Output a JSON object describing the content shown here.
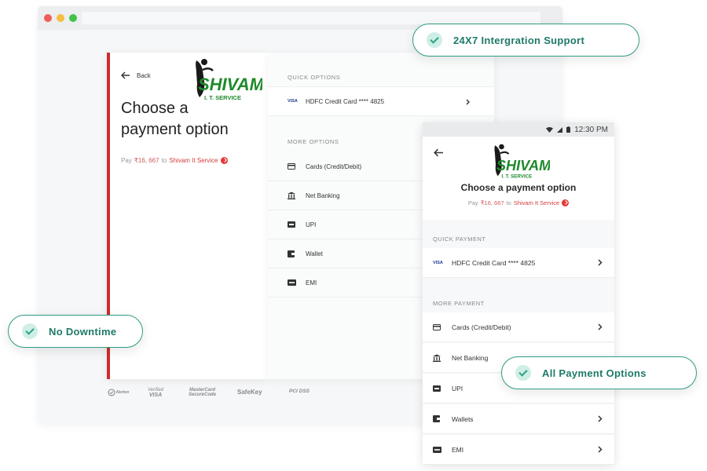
{
  "desktop": {
    "back_label": "Back",
    "title_line1": "Choose a",
    "title_line2": "payment option",
    "pay_prefix": "Pay",
    "pay_amount": "₹16, 667",
    "pay_to": "to",
    "merchant": "Shivam It Service",
    "quick_label": "QUICK OPTIONS",
    "saved_card": {
      "network": "VISA",
      "label": "HDFC Credit Card **** 4825"
    },
    "more_label": "MORE OPTIONS",
    "options": [
      {
        "label": "Cards (Credit/Debit)",
        "icon": "card-icon"
      },
      {
        "label": "Net Banking",
        "icon": "bank-icon"
      },
      {
        "label": "UPI",
        "icon": "upi-icon"
      },
      {
        "label": "Wallet",
        "icon": "wallet-icon"
      },
      {
        "label": "EMI",
        "icon": "emi-icon"
      }
    ]
  },
  "logo": {
    "name": "SHIVAM",
    "tagline": "I. T. SERVICE"
  },
  "trust_badges": {
    "norton": "Norton",
    "verified_visa_1": "Verified",
    "verified_visa_2": "VISA",
    "mastercard_1": "MasterCard",
    "mastercard_2": "SecureCode",
    "safekey": "SafeKey",
    "pci": "PCI DSS"
  },
  "mobile": {
    "time": "12:30 PM",
    "title": "Choose a payment option",
    "pay_prefix": "Pay",
    "pay_amount": "₹16, 667",
    "pay_to": "to",
    "merchant": "Shivam It Service",
    "quick_label": "QUICK PAYMENT",
    "saved_card": {
      "network": "VISA",
      "label": "HDFC Credit Card **** 4825"
    },
    "more_label": "MORE PAYMENT",
    "options": [
      {
        "label": "Cards (Credit/Debit)",
        "icon": "card-icon"
      },
      {
        "label": "Net Banking",
        "icon": "bank-icon"
      },
      {
        "label": "UPI",
        "icon": "upi-icon"
      },
      {
        "label": "Wallets",
        "icon": "wallet-icon"
      },
      {
        "label": "EMI",
        "icon": "emi-icon"
      }
    ]
  },
  "features": {
    "support": "24X7 Intergration Support",
    "downtime": "No Downtime",
    "payment_options": "All Payment Options"
  },
  "colors": {
    "accent_red": "#cf2b2b",
    "feature_green": "#1e7a68",
    "logo_green": "#1f8a2c"
  }
}
